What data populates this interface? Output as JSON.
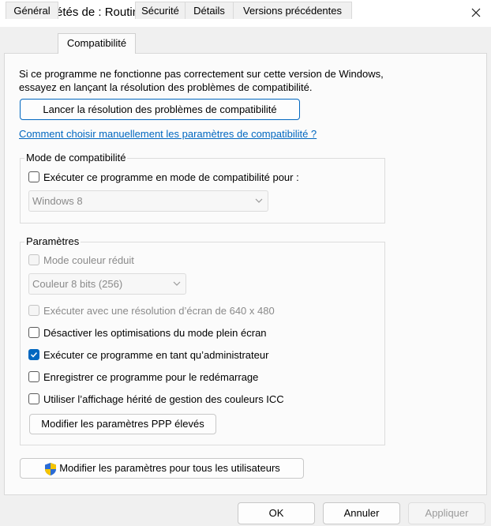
{
  "window": {
    "title": "Propriétés de : Routing Server.exe",
    "close_icon": "close-icon"
  },
  "tabs": [
    {
      "label": "Général",
      "active": false
    },
    {
      "label": "Compatibilité",
      "active": true
    },
    {
      "label": "Sécurité",
      "active": false
    },
    {
      "label": "Détails",
      "active": false
    },
    {
      "label": "Versions précédentes",
      "active": false
    }
  ],
  "intro": {
    "text_line1": "Si ce programme ne fonctionne pas correctement sur cette version de Windows,",
    "text_line2": "essayez en lançant la résolution des problèmes de compatibilité."
  },
  "troubleshoot_button": "Lancer la résolution des problèmes de compatibilité",
  "manual_link": "Comment choisir manuellement les paramètres de compatibilité ?",
  "compat_mode": {
    "legend": "Mode de compatibilité",
    "checkbox_label": "Exécuter ce programme en mode de compatibilité pour :",
    "checked": false,
    "select_value": "Windows 8"
  },
  "settings": {
    "legend": "Paramètres",
    "reduced_color_label": "Mode couleur réduit",
    "color_select_value": "Couleur 8 bits (256)",
    "res_640_label": "Exécuter avec une résolution d’écran de 640 x 480",
    "fullscreen_opt_label": "Désactiver les optimisations du mode plein écran",
    "admin_label": "Exécuter ce programme en tant qu’administrateur",
    "admin_checked": true,
    "restart_label": "Enregistrer ce programme pour le redémarrage",
    "icc_label": "Utiliser l’affichage hérité de gestion des couleurs ICC",
    "dpi_button": "Modifier les paramètres PPP élevés"
  },
  "all_users_button": "Modifier les paramètres pour tous les utilisateurs",
  "footer": {
    "ok": "OK",
    "cancel": "Annuler",
    "apply": "Appliquer"
  },
  "colors": {
    "accent": "#0067c0",
    "shield_blue": "#2b6cd4",
    "shield_yellow": "#f5c400"
  }
}
